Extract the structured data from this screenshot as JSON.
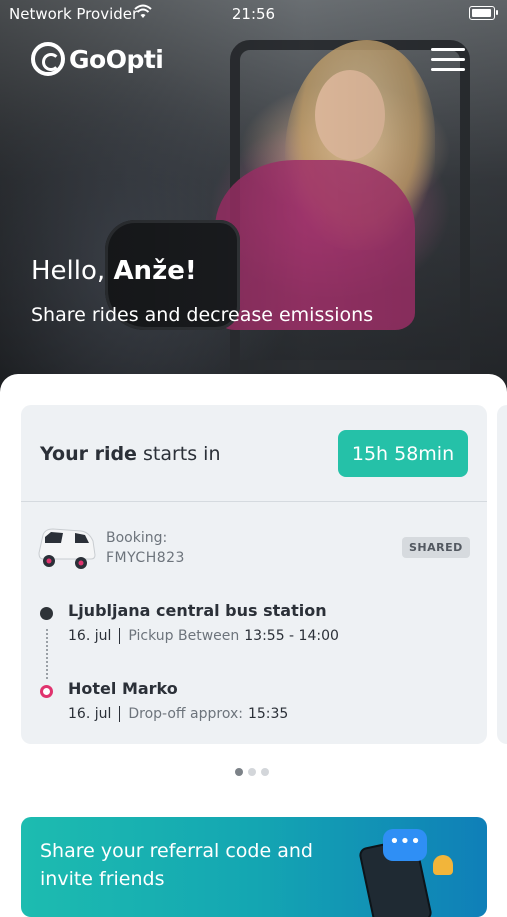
{
  "status_bar": {
    "carrier": "Network Provider",
    "time": "21:56"
  },
  "header": {
    "logo_text": "GoOpti"
  },
  "hero": {
    "greeting_prefix": "Hello, ",
    "user_name": "Anže!",
    "subtitle": "Share rides and decrease emissions"
  },
  "ride_card": {
    "title_bold": "Your ride",
    "title_rest": " starts in",
    "countdown": "15h 58min",
    "booking_label": "Booking:",
    "booking_code": "FMYCH823",
    "type_badge": "SHARED",
    "pickup": {
      "name": "Ljubljana central bus station",
      "date": "16. jul",
      "label": "Pickup Between",
      "time": "13:55 - 14:00"
    },
    "dropoff": {
      "name": "Hotel Marko",
      "date": "16. jul",
      "label": "Drop-off approx:",
      "time": "15:35"
    }
  },
  "pagination": {
    "total": 3,
    "active": 1
  },
  "promo": {
    "text": "Share your referral code and invite friends",
    "bubble_glyph": "•••"
  },
  "colors": {
    "accent_teal": "#25c1a8",
    "dropoff_pink": "#e0336e"
  }
}
